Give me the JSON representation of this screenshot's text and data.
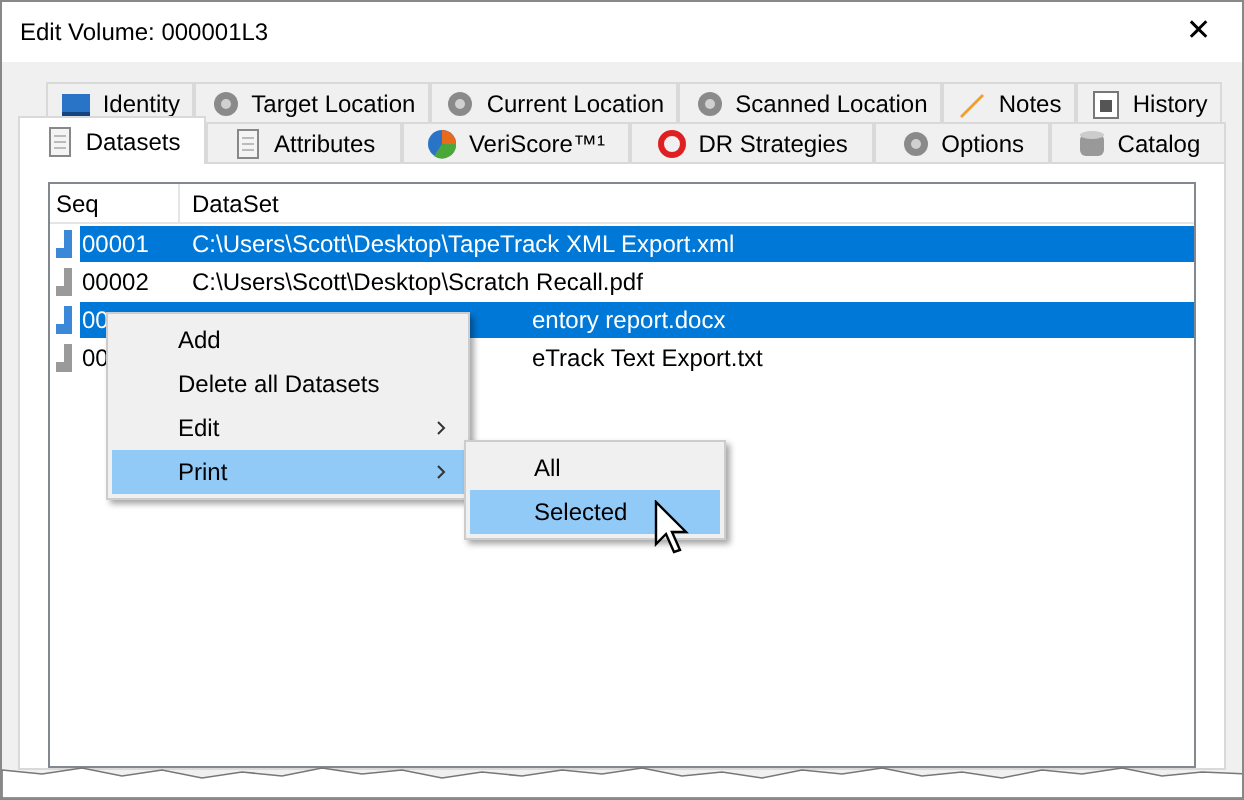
{
  "window": {
    "title": "Edit Volume: 000001L3",
    "close": "✕"
  },
  "tab_rows": [
    {
      "tabs": [
        {
          "label": "Identity",
          "kind": "blue",
          "selected": false
        },
        {
          "label": "Target Location",
          "kind": "gear",
          "selected": false
        },
        {
          "label": "Current Location",
          "kind": "gear",
          "selected": false
        },
        {
          "label": "Scanned Location",
          "kind": "gear",
          "selected": false
        },
        {
          "label": "Notes",
          "kind": "pencil",
          "selected": false
        },
        {
          "label": "History",
          "kind": "calendar",
          "selected": false
        }
      ]
    },
    {
      "tabs": [
        {
          "label": "Datasets",
          "kind": "page",
          "selected": true
        },
        {
          "label": "Attributes",
          "kind": "page",
          "selected": false
        },
        {
          "label": "VeriScore™¹",
          "kind": "pie",
          "selected": false
        },
        {
          "label": "DR Strategies",
          "kind": "ring",
          "selected": false
        },
        {
          "label": "Options",
          "kind": "gear",
          "selected": false
        },
        {
          "label": "Catalog",
          "kind": "db",
          "selected": false
        }
      ]
    }
  ],
  "table": {
    "columns": [
      "Seq",
      "DataSet"
    ],
    "rows": [
      {
        "seq": "00001",
        "dataset": "C:\\Users\\Scott\\Desktop\\TapeTrack XML Export.xml",
        "selected": true,
        "covered": false
      },
      {
        "seq": "00002",
        "dataset": "C:\\Users\\Scott\\Desktop\\Scratch Recall.pdf",
        "selected": false,
        "covered": false
      },
      {
        "seq": "00",
        "dataset": "entory report.docx",
        "selected": true,
        "covered": true
      },
      {
        "seq": "00",
        "dataset": "eTrack Text Export.txt",
        "selected": false,
        "covered": true
      }
    ]
  },
  "context_menu": {
    "items": [
      {
        "label": "Add",
        "submenu": false,
        "selected": false
      },
      {
        "label": "Delete all Datasets",
        "submenu": false,
        "selected": false
      },
      {
        "label": "Edit",
        "submenu": true,
        "selected": false
      },
      {
        "label": "Print",
        "submenu": true,
        "selected": true
      }
    ],
    "submenu": {
      "items": [
        {
          "label": "All",
          "selected": false
        },
        {
          "label": "Selected",
          "selected": true
        }
      ]
    }
  }
}
